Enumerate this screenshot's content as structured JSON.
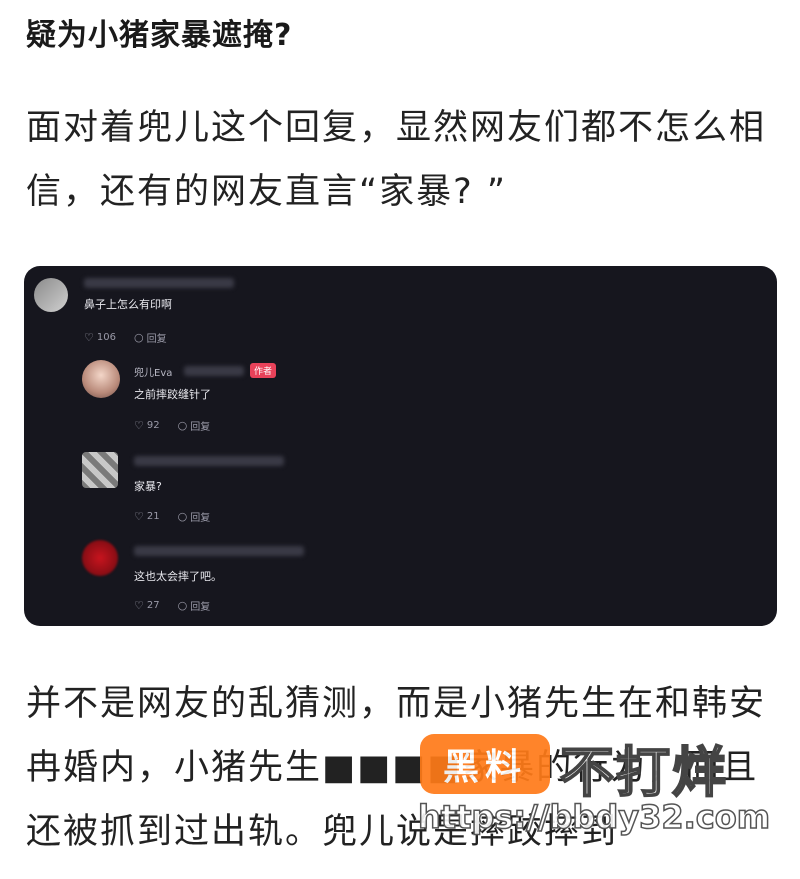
{
  "heading": "疑为小猪家暴遮掩?",
  "para1": "面对着兜儿这个回复，显然网友们都不怎么相信，还有的网友直言“家暴? ”",
  "para2": "并不是网友的乱猜测，而是小猪先生在和韩安冉婚内，小猪先生■■■■家暴的行为，而且还被抓到过出轨。兜儿说是摔跤摔到",
  "comments": [
    {
      "text": "鼻子上怎么有印啊",
      "likes": "106",
      "reply": "回复"
    },
    {
      "name": "兜儿Eva",
      "badge": "作者",
      "text": "之前摔跤缝针了",
      "likes": "92",
      "reply": "回复"
    },
    {
      "text": "家暴?",
      "likes": "21",
      "reply": "回复"
    },
    {
      "text": "这也太会摔了吧。",
      "likes": "27",
      "reply": "回复"
    }
  ],
  "watermark": {
    "box": "黑料",
    "text": "不打烊",
    "url": "https://bbdy32.com"
  }
}
